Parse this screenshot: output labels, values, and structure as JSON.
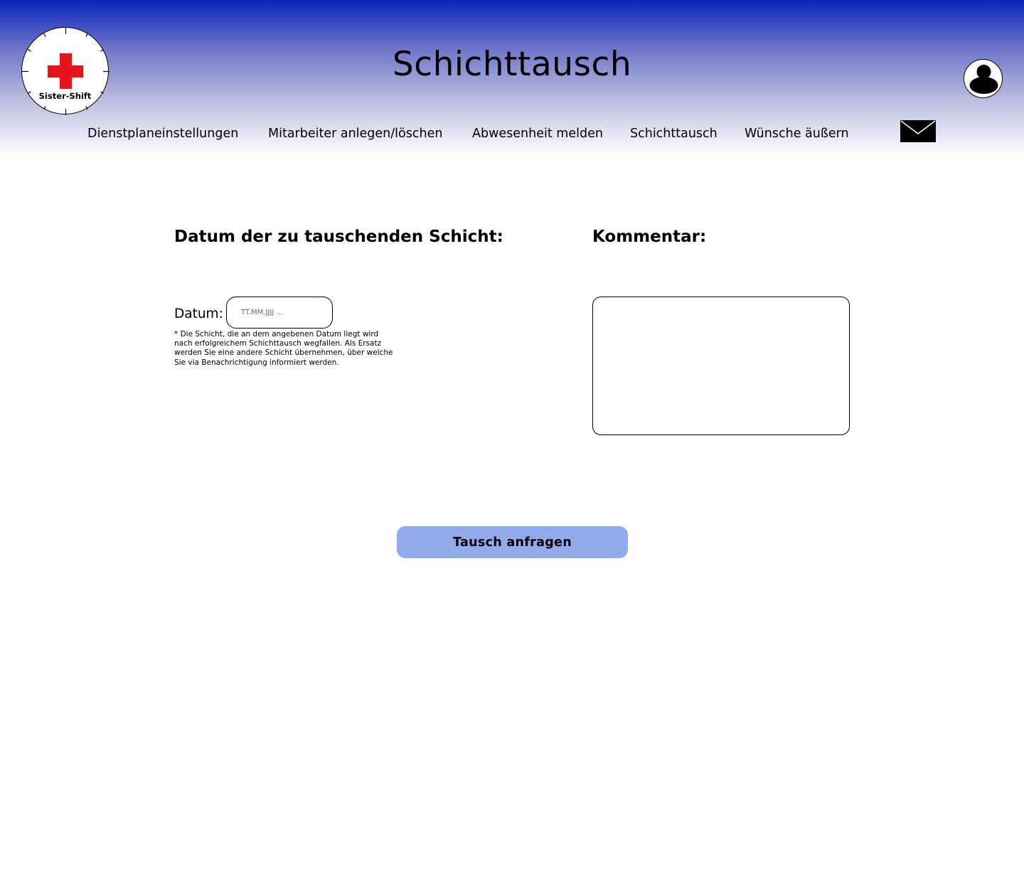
{
  "header": {
    "logo_text": "Sister-Shift",
    "title": "Schichttausch",
    "nav": [
      {
        "label": "Dienstplaneinstellungen"
      },
      {
        "label": "Mitarbeiter anlegen/löschen"
      },
      {
        "label": "Abwesenheit melden"
      },
      {
        "label": "Schichttausch",
        "active": true
      },
      {
        "label": "Wünsche äußern"
      }
    ]
  },
  "form": {
    "date_section_title": "Datum der zu tauschenden Schicht:",
    "date_label": "Datum:",
    "date_placeholder": "TT.MM.JJJJ ...",
    "hint": "* Die Schicht, die an dem angebenen Datum liegt wird nach erfolgreichem Schichttausch wegfallen. Als Ersatz werden Sie eine andere Schicht übernehmen, über welche Sie via Benachrichtigung informiert werden.",
    "comment_section_title": "Kommentar:",
    "comment_value": "",
    "submit_label": "Tausch anfragen"
  },
  "colors": {
    "header_top": "#0a23bf",
    "accent_button": "#93abec",
    "cross_red": "#e8141c"
  },
  "icons": {
    "logo": "red-cross-clock-icon",
    "profile": "user-avatar-icon",
    "mail": "envelope-icon"
  }
}
